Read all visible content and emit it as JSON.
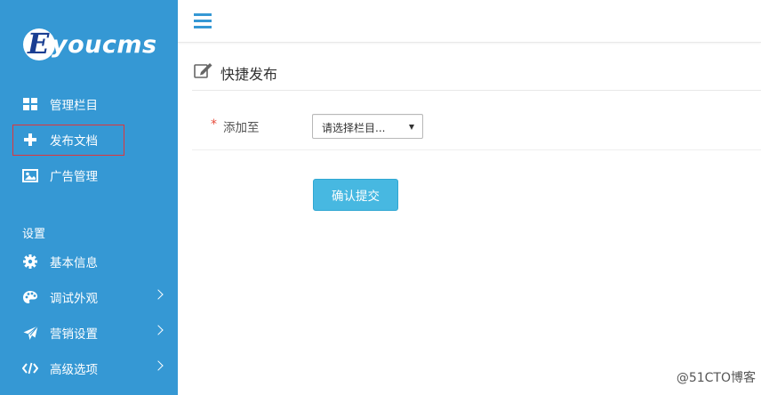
{
  "brand": {
    "logo_letter": "E",
    "logo_text": "youcms"
  },
  "sidebar": {
    "items": [
      {
        "label": "管理栏目",
        "icon": "grid-icon"
      },
      {
        "label": "发布文档",
        "icon": "plus-icon",
        "highlighted": true
      },
      {
        "label": "广告管理",
        "icon": "image-icon"
      }
    ],
    "section_label": "设置",
    "settings_items": [
      {
        "label": "基本信息",
        "icon": "gear-icon"
      },
      {
        "label": "调试外观",
        "icon": "palette-icon",
        "has_submenu": true
      },
      {
        "label": "营销设置",
        "icon": "paper-plane-icon",
        "has_submenu": true
      },
      {
        "label": "高级选项",
        "icon": "code-icon",
        "has_submenu": true
      }
    ]
  },
  "header": {
    "menu_icon": "hamburger-icon"
  },
  "page": {
    "title": "快捷发布",
    "title_icon": "edit-icon"
  },
  "form": {
    "required_mark": "*",
    "field_label": "添加至",
    "select_value": "请选择栏目...",
    "submit_label": "确认提交"
  },
  "watermark": "@51CTO博客",
  "colors": {
    "sidebar_bg": "#3598d4",
    "accent": "#3598d4",
    "submit_bg": "#47b8e1",
    "required": "#e74c3c",
    "highlight_border": "#e0353a"
  }
}
